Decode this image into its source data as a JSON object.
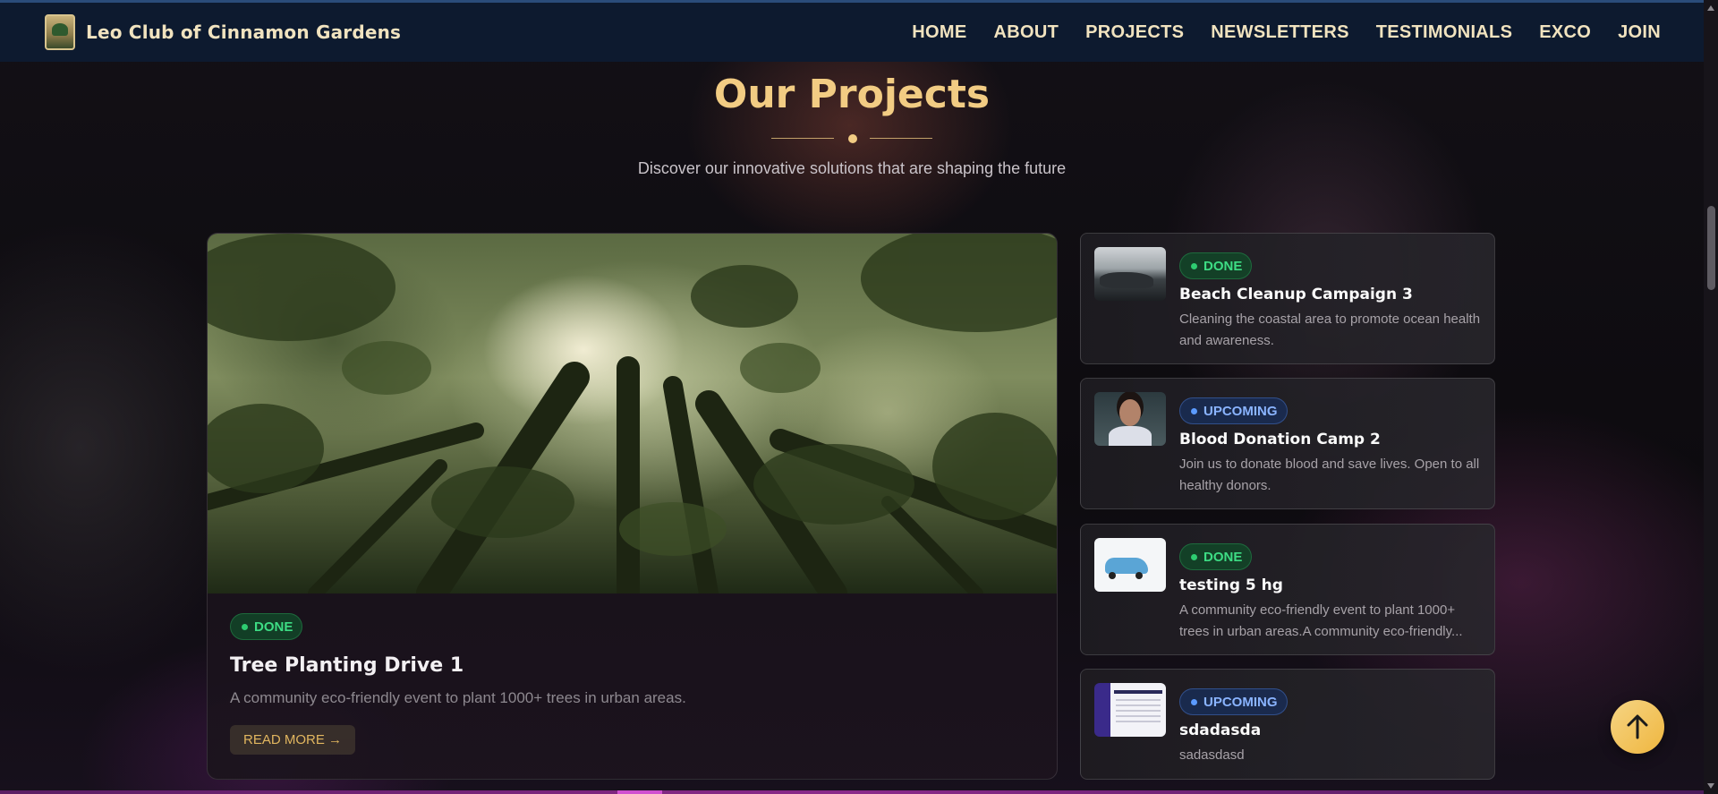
{
  "brand": {
    "name": "Leo Club of Cinnamon Gardens",
    "logo_icon": "club-logo-icon"
  },
  "nav": {
    "items": [
      {
        "label": "HOME"
      },
      {
        "label": "ABOUT"
      },
      {
        "label": "PROJECTS"
      },
      {
        "label": "NEWSLETTERS"
      },
      {
        "label": "TESTIMONIALS"
      },
      {
        "label": "EXCO"
      },
      {
        "label": "JOIN"
      }
    ]
  },
  "section": {
    "title": "Our Projects",
    "subtitle": "Discover our innovative solutions that are shaping the future"
  },
  "featured": {
    "status": "DONE",
    "title": "Tree Planting Drive 1",
    "description": "A community eco-friendly event to plant 1000+ trees in urban areas.",
    "read_more": "READ MORE →",
    "image": "forest-canopy-image"
  },
  "projects": [
    {
      "status": "DONE",
      "title": "Beach Cleanup Campaign 3",
      "description": "Cleaning the coastal area to promote ocean health and awareness.",
      "image": "beach-rocks-thumbnail"
    },
    {
      "status": "UPCOMING",
      "title": "Blood Donation Camp 2",
      "description": "Join us to donate blood and save lives. Open to all healthy donors.",
      "image": "person-portrait-thumbnail"
    },
    {
      "status": "DONE",
      "title": "testing 5 hg",
      "description": "A community eco-friendly event to plant 1000+ trees in urban areas.A community eco-friendly...",
      "image": "car-drawing-thumbnail"
    },
    {
      "status": "UPCOMING",
      "title": "sdadasda",
      "description": "sadasdasd",
      "image": "spreadsheet-thumbnail"
    }
  ],
  "colors": {
    "accent_gold": "#f2cc83",
    "nav_bg": "#0d1a2f",
    "done_green": "#3ddc84",
    "upcoming_blue": "#8ab4ff"
  },
  "back_to_top": {
    "icon": "arrow-up-icon"
  }
}
